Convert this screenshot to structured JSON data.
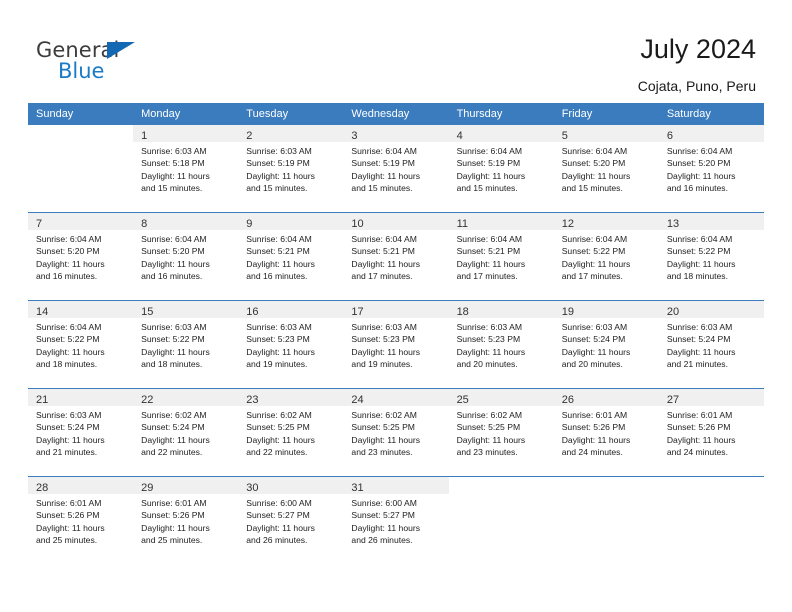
{
  "brand": {
    "name_part1": "General",
    "name_part2": "Blue",
    "accent_color": "#1a7bc6",
    "triangle_color": "#1268b3"
  },
  "header": {
    "title": "July 2024",
    "subtitle": "Cojata, Puno, Peru"
  },
  "calendar": {
    "header_bg": "#3a7cbe",
    "header_text_color": "#ffffff",
    "daynum_bg": "#f0f0f0",
    "weekdays": [
      "Sunday",
      "Monday",
      "Tuesday",
      "Wednesday",
      "Thursday",
      "Friday",
      "Saturday"
    ],
    "weeks": [
      [
        {
          "day": "",
          "lines": []
        },
        {
          "day": "1",
          "lines": [
            "Sunrise: 6:03 AM",
            "Sunset: 5:18 PM",
            "Daylight: 11 hours",
            "and 15 minutes."
          ]
        },
        {
          "day": "2",
          "lines": [
            "Sunrise: 6:03 AM",
            "Sunset: 5:19 PM",
            "Daylight: 11 hours",
            "and 15 minutes."
          ]
        },
        {
          "day": "3",
          "lines": [
            "Sunrise: 6:04 AM",
            "Sunset: 5:19 PM",
            "Daylight: 11 hours",
            "and 15 minutes."
          ]
        },
        {
          "day": "4",
          "lines": [
            "Sunrise: 6:04 AM",
            "Sunset: 5:19 PM",
            "Daylight: 11 hours",
            "and 15 minutes."
          ]
        },
        {
          "day": "5",
          "lines": [
            "Sunrise: 6:04 AM",
            "Sunset: 5:20 PM",
            "Daylight: 11 hours",
            "and 15 minutes."
          ]
        },
        {
          "day": "6",
          "lines": [
            "Sunrise: 6:04 AM",
            "Sunset: 5:20 PM",
            "Daylight: 11 hours",
            "and 16 minutes."
          ]
        }
      ],
      [
        {
          "day": "7",
          "lines": [
            "Sunrise: 6:04 AM",
            "Sunset: 5:20 PM",
            "Daylight: 11 hours",
            "and 16 minutes."
          ]
        },
        {
          "day": "8",
          "lines": [
            "Sunrise: 6:04 AM",
            "Sunset: 5:20 PM",
            "Daylight: 11 hours",
            "and 16 minutes."
          ]
        },
        {
          "day": "9",
          "lines": [
            "Sunrise: 6:04 AM",
            "Sunset: 5:21 PM",
            "Daylight: 11 hours",
            "and 16 minutes."
          ]
        },
        {
          "day": "10",
          "lines": [
            "Sunrise: 6:04 AM",
            "Sunset: 5:21 PM",
            "Daylight: 11 hours",
            "and 17 minutes."
          ]
        },
        {
          "day": "11",
          "lines": [
            "Sunrise: 6:04 AM",
            "Sunset: 5:21 PM",
            "Daylight: 11 hours",
            "and 17 minutes."
          ]
        },
        {
          "day": "12",
          "lines": [
            "Sunrise: 6:04 AM",
            "Sunset: 5:22 PM",
            "Daylight: 11 hours",
            "and 17 minutes."
          ]
        },
        {
          "day": "13",
          "lines": [
            "Sunrise: 6:04 AM",
            "Sunset: 5:22 PM",
            "Daylight: 11 hours",
            "and 18 minutes."
          ]
        }
      ],
      [
        {
          "day": "14",
          "lines": [
            "Sunrise: 6:04 AM",
            "Sunset: 5:22 PM",
            "Daylight: 11 hours",
            "and 18 minutes."
          ]
        },
        {
          "day": "15",
          "lines": [
            "Sunrise: 6:03 AM",
            "Sunset: 5:22 PM",
            "Daylight: 11 hours",
            "and 18 minutes."
          ]
        },
        {
          "day": "16",
          "lines": [
            "Sunrise: 6:03 AM",
            "Sunset: 5:23 PM",
            "Daylight: 11 hours",
            "and 19 minutes."
          ]
        },
        {
          "day": "17",
          "lines": [
            "Sunrise: 6:03 AM",
            "Sunset: 5:23 PM",
            "Daylight: 11 hours",
            "and 19 minutes."
          ]
        },
        {
          "day": "18",
          "lines": [
            "Sunrise: 6:03 AM",
            "Sunset: 5:23 PM",
            "Daylight: 11 hours",
            "and 20 minutes."
          ]
        },
        {
          "day": "19",
          "lines": [
            "Sunrise: 6:03 AM",
            "Sunset: 5:24 PM",
            "Daylight: 11 hours",
            "and 20 minutes."
          ]
        },
        {
          "day": "20",
          "lines": [
            "Sunrise: 6:03 AM",
            "Sunset: 5:24 PM",
            "Daylight: 11 hours",
            "and 21 minutes."
          ]
        }
      ],
      [
        {
          "day": "21",
          "lines": [
            "Sunrise: 6:03 AM",
            "Sunset: 5:24 PM",
            "Daylight: 11 hours",
            "and 21 minutes."
          ]
        },
        {
          "day": "22",
          "lines": [
            "Sunrise: 6:02 AM",
            "Sunset: 5:24 PM",
            "Daylight: 11 hours",
            "and 22 minutes."
          ]
        },
        {
          "day": "23",
          "lines": [
            "Sunrise: 6:02 AM",
            "Sunset: 5:25 PM",
            "Daylight: 11 hours",
            "and 22 minutes."
          ]
        },
        {
          "day": "24",
          "lines": [
            "Sunrise: 6:02 AM",
            "Sunset: 5:25 PM",
            "Daylight: 11 hours",
            "and 23 minutes."
          ]
        },
        {
          "day": "25",
          "lines": [
            "Sunrise: 6:02 AM",
            "Sunset: 5:25 PM",
            "Daylight: 11 hours",
            "and 23 minutes."
          ]
        },
        {
          "day": "26",
          "lines": [
            "Sunrise: 6:01 AM",
            "Sunset: 5:26 PM",
            "Daylight: 11 hours",
            "and 24 minutes."
          ]
        },
        {
          "day": "27",
          "lines": [
            "Sunrise: 6:01 AM",
            "Sunset: 5:26 PM",
            "Daylight: 11 hours",
            "and 24 minutes."
          ]
        }
      ],
      [
        {
          "day": "28",
          "lines": [
            "Sunrise: 6:01 AM",
            "Sunset: 5:26 PM",
            "Daylight: 11 hours",
            "and 25 minutes."
          ]
        },
        {
          "day": "29",
          "lines": [
            "Sunrise: 6:01 AM",
            "Sunset: 5:26 PM",
            "Daylight: 11 hours",
            "and 25 minutes."
          ]
        },
        {
          "day": "30",
          "lines": [
            "Sunrise: 6:00 AM",
            "Sunset: 5:27 PM",
            "Daylight: 11 hours",
            "and 26 minutes."
          ]
        },
        {
          "day": "31",
          "lines": [
            "Sunrise: 6:00 AM",
            "Sunset: 5:27 PM",
            "Daylight: 11 hours",
            "and 26 minutes."
          ]
        },
        {
          "day": "",
          "lines": []
        },
        {
          "day": "",
          "lines": []
        },
        {
          "day": "",
          "lines": []
        }
      ]
    ]
  }
}
